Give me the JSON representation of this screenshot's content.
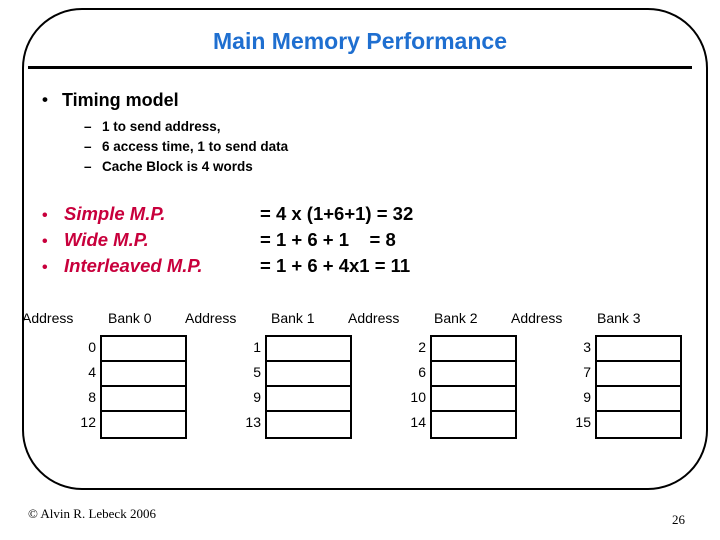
{
  "slide": {
    "title": "Main Memory Performance",
    "title_color": "#1F6FD0",
    "accent_color": "#C8003C",
    "page_number": "26",
    "credit": "© Alvin R. Lebeck 2006"
  },
  "bullets": {
    "heading_marker": "•",
    "heading": "Timing model",
    "sub_marker": "–",
    "sub_items": [
      "1 to send address,",
      "6 access time, 1 to send data",
      "Cache Block is 4 words"
    ]
  },
  "mp_rows": [
    {
      "marker": "•",
      "label": "Simple M.P.",
      "equation": "= 4 x (1+6+1) = 32"
    },
    {
      "marker": "•",
      "label": "Wide M.P.",
      "equation": "= 1 + 6 + 1    = 8"
    },
    {
      "marker": "•",
      "label": "Interleaved M.P.",
      "equation": "= 1 + 6 + 4x1 = 11"
    }
  ],
  "bank_table": {
    "address_header": "Address",
    "groups": [
      {
        "bank_header": "Bank 0",
        "addresses": [
          "0",
          "4",
          "8",
          "12"
        ]
      },
      {
        "bank_header": "Bank 1",
        "addresses": [
          "1",
          "5",
          "9",
          "13"
        ]
      },
      {
        "bank_header": "Bank 2",
        "addresses": [
          "2",
          "6",
          "10",
          "14"
        ]
      },
      {
        "bank_header": "Bank 3",
        "addresses": [
          "3",
          "7",
          "9",
          "15"
        ]
      }
    ]
  }
}
